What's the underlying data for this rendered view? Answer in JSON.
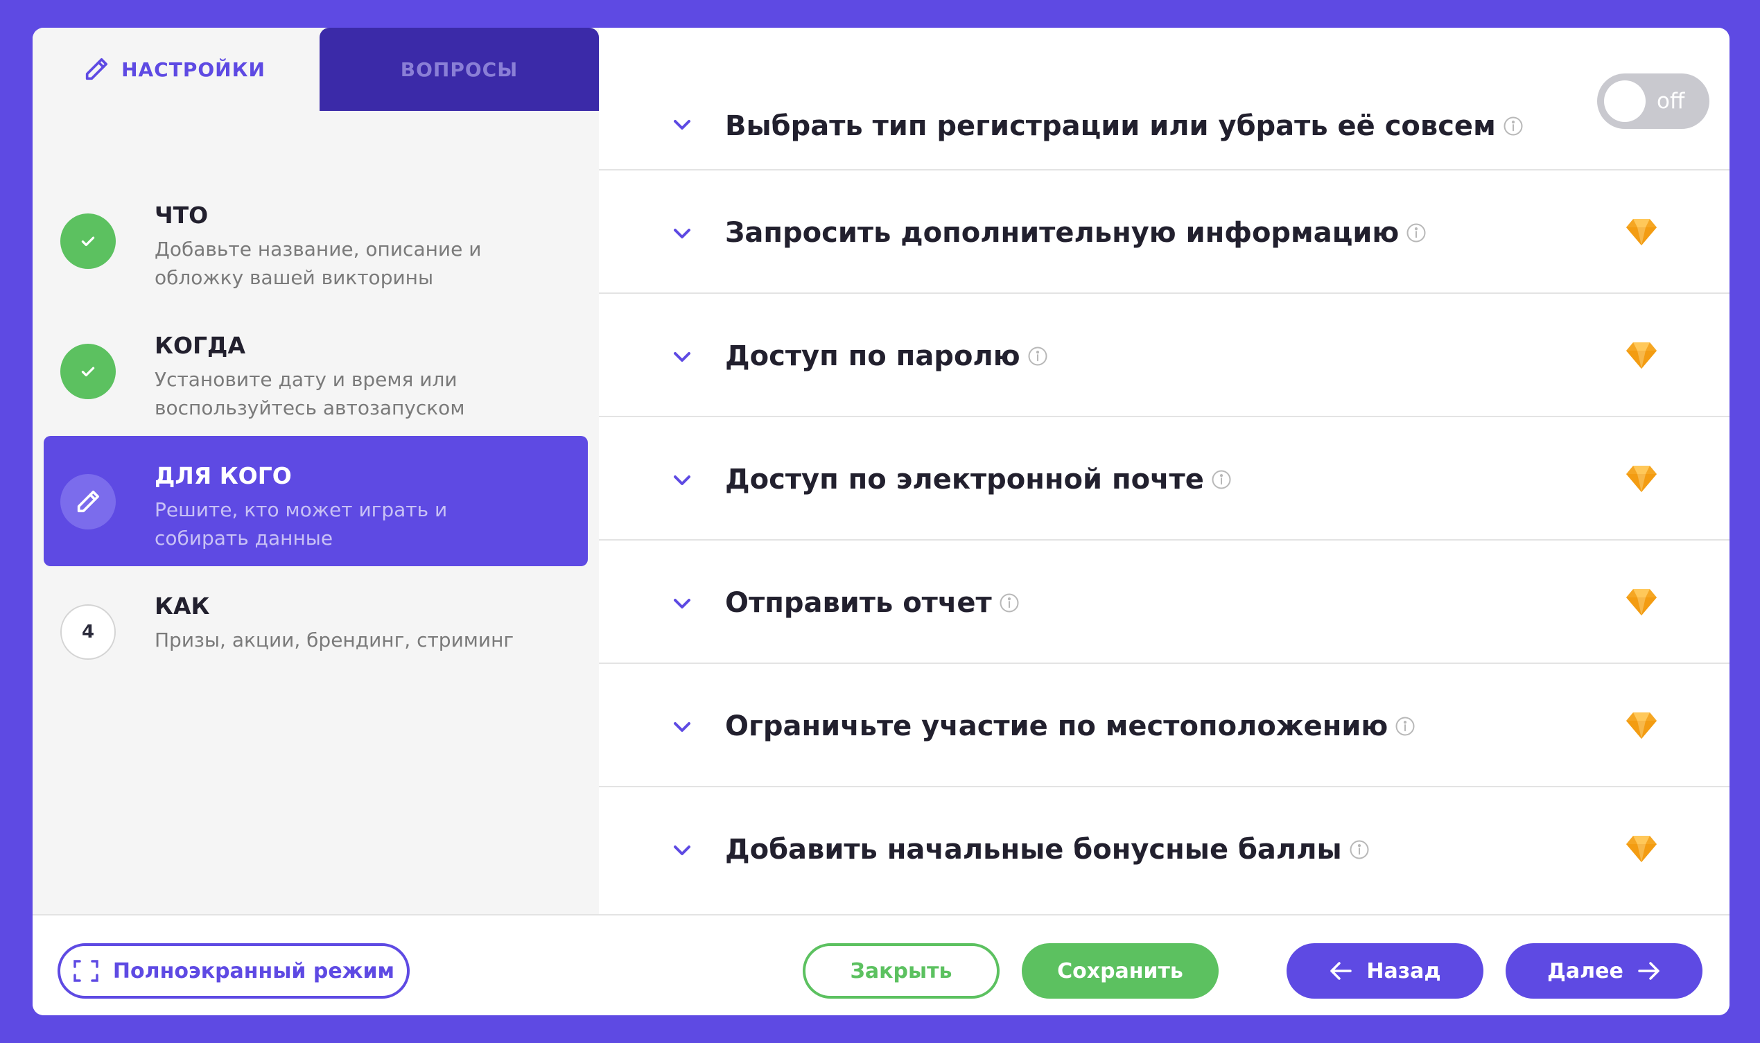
{
  "tabs": {
    "settings": "НАСТРОЙКИ",
    "questions": "ВОПРОСЫ"
  },
  "steps": [
    {
      "title": "ЧТО",
      "desc": "Добавьте название, описание и обложку вашей викторины",
      "state": "done"
    },
    {
      "title": "КОГДА",
      "desc": "Установите дату и время или воспользуйтесь автозапуском",
      "state": "done"
    },
    {
      "title": "ДЛЯ КОГО",
      "desc": "Решите, кто может играть и собирать данные",
      "state": "current"
    },
    {
      "title": "КАК",
      "desc": "Призы, акции, брендинг, стриминг",
      "state": "todo",
      "number": "4"
    }
  ],
  "settings_rows": [
    {
      "label": "Выбрать тип регистрации или убрать её совсем",
      "control": "toggle",
      "toggle_text": "off"
    },
    {
      "label": "Запросить дополнительную информацию",
      "control": "premium-gem-icon"
    },
    {
      "label": "Доступ по паролю",
      "control": "premium-gem-icon"
    },
    {
      "label": "Доступ по электронной почте",
      "control": "premium-gem-icon"
    },
    {
      "label": "Отправить отчет",
      "control": "premium-gem-icon"
    },
    {
      "label": "Ограничьте участие по местоположению",
      "control": "premium-gem-icon"
    },
    {
      "label": "Добавить начальные бонусные баллы",
      "control": "premium-gem-icon"
    }
  ],
  "footer": {
    "fullscreen": "Полноэкранный режим",
    "close": "Закрыть",
    "save": "Сохранить",
    "back": "Назад",
    "next": "Далее"
  },
  "colors": {
    "accent": "#5e4ae3",
    "success": "#5cc160",
    "premium": "#f5a623",
    "toggle_off": "#c9c9cf"
  }
}
